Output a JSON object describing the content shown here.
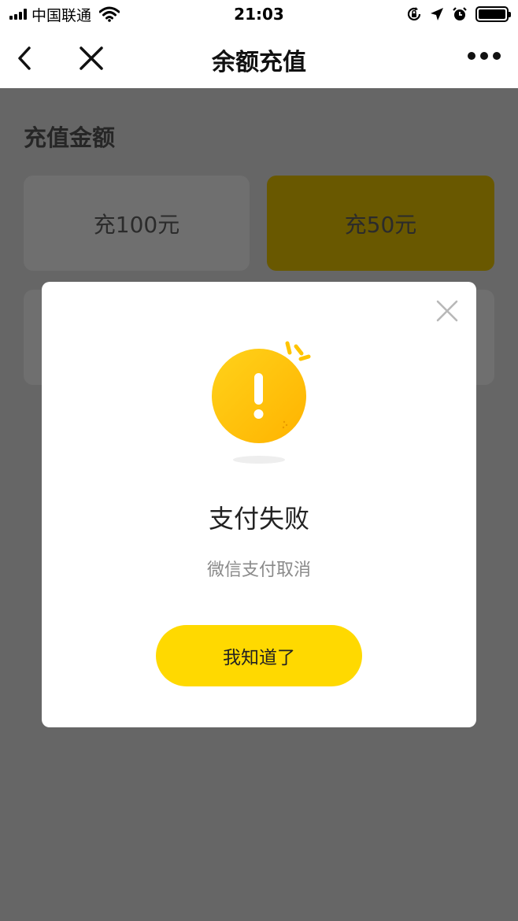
{
  "status_bar": {
    "carrier": "中国联通",
    "time": "21:03",
    "icons": [
      "signal-icon",
      "wifi-icon",
      "orientation-lock-icon",
      "location-icon",
      "alarm-icon",
      "battery-icon"
    ]
  },
  "nav": {
    "title": "余额充值",
    "icons": [
      "back-icon",
      "close-icon",
      "more-icon"
    ]
  },
  "page": {
    "section_title": "充值金额",
    "amounts": [
      {
        "label": "充100元",
        "selected": false
      },
      {
        "label": "充50元",
        "selected": true
      }
    ]
  },
  "dialog": {
    "icon": "warning-icon",
    "title": "支付失败",
    "message": "微信支付取消",
    "confirm_label": "我知道了",
    "close_icon": "close-icon"
  },
  "colors": {
    "accent": "#ffd900",
    "overlay": "#666666",
    "selected_card": "#695800",
    "warning_gradient_start": "#ffd21a",
    "warning_gradient_end": "#ffb300"
  }
}
